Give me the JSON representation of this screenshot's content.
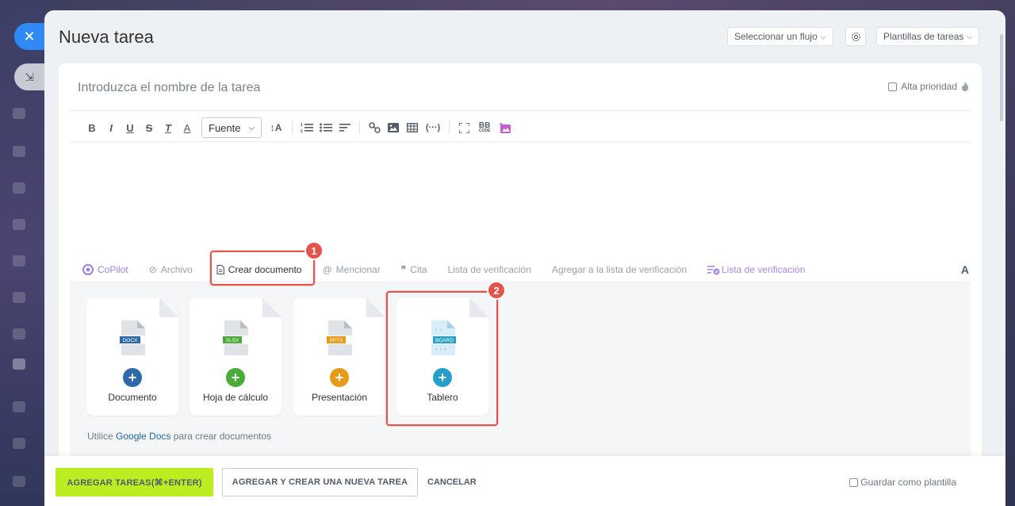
{
  "header": {
    "title": "Nueva tarea",
    "flow_label": "Seleccionar un flujo",
    "templates_label": "Plantillas de tareas"
  },
  "task": {
    "title_placeholder": "Introduzca el nombre de la tarea",
    "priority_label": "Alta prioridad"
  },
  "toolbar": {
    "bold": "B",
    "italic": "I",
    "underline": "U",
    "strike": "S",
    "clear_format": "T",
    "text_color": "A",
    "font_label": "Fuente",
    "font_size": "↕A",
    "bbcode": "BB"
  },
  "attach_bar": {
    "copilot": "CoPilot",
    "file": "Archivo",
    "create_doc": "Crear documento",
    "mention": "Mencionar",
    "quote": "Cita",
    "checklist": "Lista de verificación",
    "add_to_checklist": "Agregar a la lista de verificación",
    "checklist2": "Lista de verificación",
    "font_toggle": "A"
  },
  "badges": {
    "one": "1",
    "two": "2"
  },
  "documents": {
    "tiles": [
      {
        "label": "Documento",
        "ext": "DOCX",
        "color": "#2f6aa8"
      },
      {
        "label": "Hoja de cálculo",
        "ext": "XLSX",
        "color": "#4bab38"
      },
      {
        "label": "Presentación",
        "ext": "PPTX",
        "color": "#e89b18"
      },
      {
        "label": "Tablero",
        "ext": "BOARD",
        "color": "#27a0c9"
      }
    ],
    "gdocs_prefix": "Utilice",
    "gdocs_link": "Google Docs",
    "gdocs_suffix": "para crear documentos"
  },
  "footer": {
    "add_tasks": "AGREGAR TAREAS(⌘+ENTER)",
    "add_and_new": "AGREGAR Y CREAR UNA NUEVA TAREA",
    "cancel": "CANCELAR",
    "save_template": "Guardar como plantilla"
  },
  "colors": {
    "accent_blue": "#2f8af5",
    "primary_green": "#bbed21",
    "highlight_red": "#e3544d"
  }
}
